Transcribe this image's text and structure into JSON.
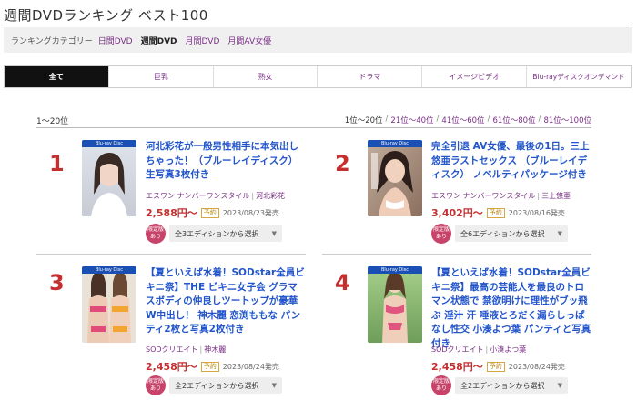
{
  "page": {
    "title": "週間DVDランキング ベスト100"
  },
  "category": {
    "label": "ランキングカテゴリー",
    "links": [
      {
        "label": "日間DVD",
        "current": false
      },
      {
        "label": "週間DVD",
        "current": true
      },
      {
        "label": "月間DVD",
        "current": false
      },
      {
        "label": "月間AV女優",
        "current": false
      }
    ]
  },
  "tabs": [
    {
      "label": "全て",
      "active": true
    },
    {
      "label": "巨乳",
      "active": false
    },
    {
      "label": "熟女",
      "active": false
    },
    {
      "label": "ドラマ",
      "active": false
    },
    {
      "label": "イメージビデオ",
      "active": false
    },
    {
      "label": "Blu-rayディスクオンデマンド",
      "active": false
    }
  ],
  "range": {
    "current": "1～20位",
    "pages": [
      "1位～20位",
      "21位～40位",
      "41位～60位",
      "61位～80位",
      "81位～100位"
    ]
  },
  "items": [
    {
      "rank": "1",
      "badge": "Blu-ray Disc",
      "title": "河北彩花が一般男性相手に本気出しちゃった！（ブルーレイディスク） 生写真3枚付き",
      "maker": "エスワン ナンバーワンスタイル",
      "actress": "河北彩花",
      "price": "2,588円～",
      "preorder": "予約",
      "release": "2023/08/23発売",
      "limited": "限定版あり",
      "edition": "全3エディションから選択"
    },
    {
      "rank": "2",
      "badge": "Blu-ray Disc",
      "title": "完全引退 AV女優、最後の1日。三上悠亜ラストセックス （ブルーレイディスク） ノベルティパッケージ付き",
      "maker": "エスワン ナンバーワンスタイル",
      "actress": "三上悠亜",
      "price": "3,402円～",
      "preorder": "予約",
      "release": "2023/08/16発売",
      "limited": "限定版あり",
      "edition": "全6エディションから選択"
    },
    {
      "rank": "3",
      "badge": "Blu-ray Disc",
      "title": "【夏といえば水着！SODstar全員ビキニ祭】THE ビキニ女子会 グラマスボディの仲良しツートップが豪華W中出し！ 神木麗 恋渕ももな パンティ2枚と写真2枚付き",
      "maker": "SODクリエイト",
      "actress": "神木麗",
      "price": "2,458円～",
      "preorder": "予約",
      "release": "2023/08/24発売",
      "limited": "限定版あり",
      "edition": "全2エディションから選択"
    },
    {
      "rank": "4",
      "badge": "Blu-ray Disc",
      "title": "【夏といえば水着！SODstar全員ビキニ祭】最高の芸能人を最良のトロマン状態で 禁欲明けに理性がブッ飛ぶ 淫汁 汗 唾液とろだく漏らしっぱなし性交 小湊よつ葉 パンティと写真付き",
      "maker": "SODクリエイト",
      "actress": "小湊よつ葉",
      "price": "2,458円～",
      "preorder": "予約",
      "release": "2023/08/24発売",
      "limited": "限定版あり",
      "edition": "全2エディションから選択"
    }
  ]
}
